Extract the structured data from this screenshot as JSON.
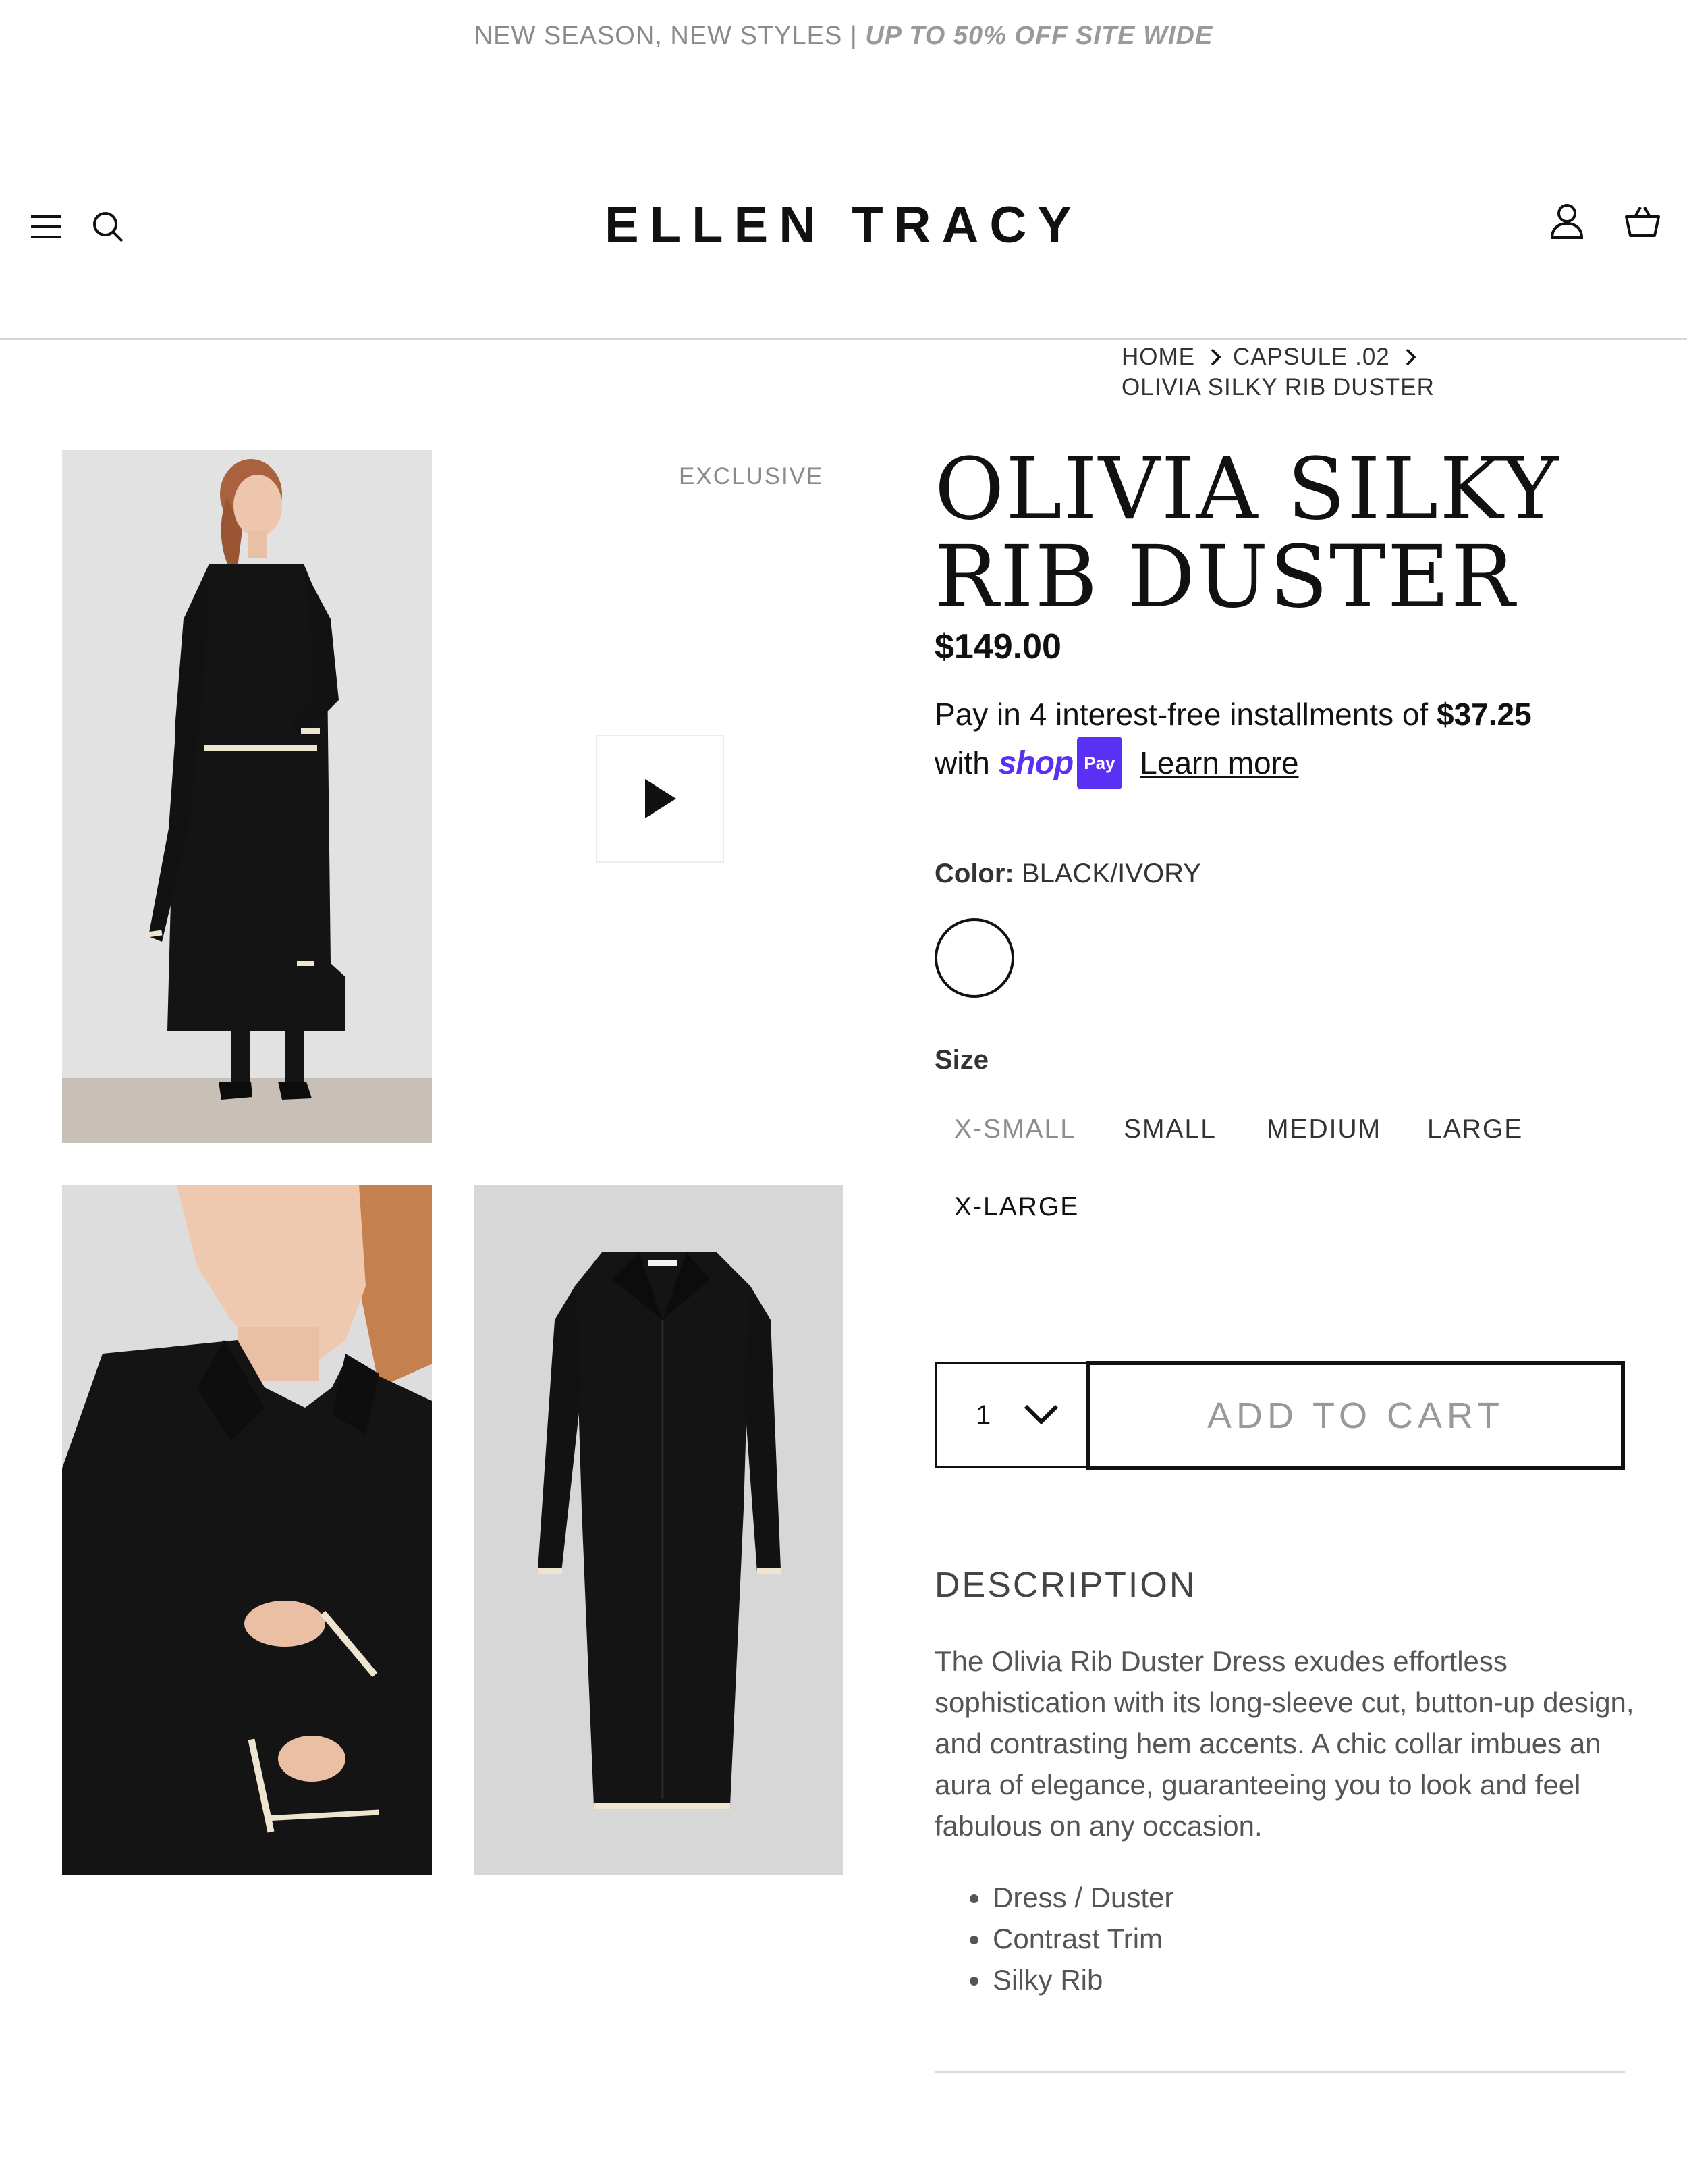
{
  "announcement": {
    "text": "NEW SEASON, NEW STYLES | ",
    "highlight": "UP TO 50% OFF SITE WIDE"
  },
  "header": {
    "logo": "ELLEN TRACY",
    "icons": [
      "menu-icon",
      "search-icon",
      "account-icon",
      "cart-icon"
    ]
  },
  "breadcrumb": {
    "home": "HOME",
    "collection": "CAPSULE .02",
    "current": "OLIVIA SILKY RIB DUSTER"
  },
  "gallery": {
    "badge": "EXCLUSIVE"
  },
  "product": {
    "title": "OLIVIA SILKY RIB DUSTER",
    "price": "$149.00",
    "installments": {
      "prefix": "Pay in 4 interest-free installments of ",
      "amount": "$37.25",
      "with": "with ",
      "shop": "shop",
      "pay": "Pay",
      "learn_more": "Learn more"
    },
    "color": {
      "label": "Color:",
      "value": "BLACK/IVORY"
    },
    "size": {
      "label": "Size",
      "options": [
        "X-SMALL",
        "SMALL",
        "MEDIUM",
        "LARGE",
        "X-LARGE"
      ]
    },
    "quantity": "1",
    "add_to_cart": "ADD TO CART"
  },
  "description": {
    "heading": "DESCRIPTION",
    "body": "The Olivia Rib Duster Dress exudes effortless sophistication with its long-sleeve cut, button-up design, and contrasting hem accents. A chic collar imbues an aura of elegance, guaranteeing you to look and feel fabulous on any occasion.",
    "bullets": [
      "Dress / Duster",
      "Contrast Trim",
      "Silky Rib"
    ]
  },
  "colors": {
    "accent": "#5a31f4",
    "text": "#111111",
    "muted": "#8a8a8a"
  }
}
